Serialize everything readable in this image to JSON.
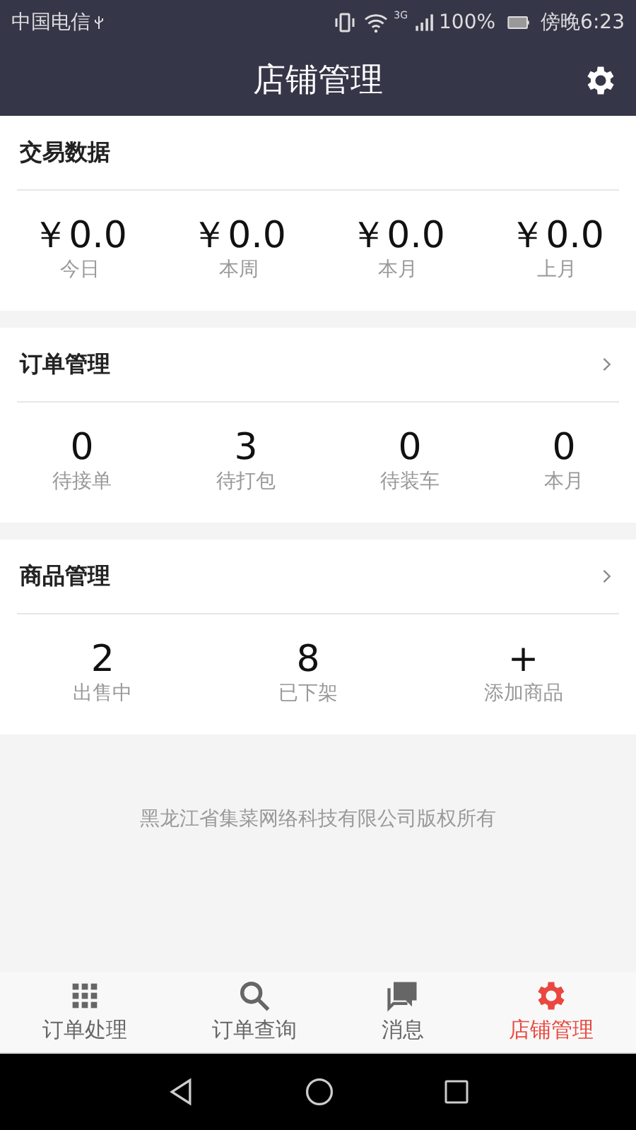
{
  "status_bar": {
    "carrier": "中国电信",
    "network": "3G",
    "battery": "100%",
    "time": "傍晚6:23"
  },
  "header": {
    "title": "店铺管理"
  },
  "sections": [
    {
      "title": "交易数据",
      "kind": "plain",
      "stats": [
        {
          "value": "￥0.0",
          "label": "今日"
        },
        {
          "value": "￥0.0",
          "label": "本周"
        },
        {
          "value": "￥0.0",
          "label": "本月"
        },
        {
          "value": "￥0.0",
          "label": "上月"
        }
      ]
    },
    {
      "title": "订单管理",
      "kind": "link",
      "stats": [
        {
          "value": "0",
          "label": "待接单"
        },
        {
          "value": "3",
          "label": "待打包"
        },
        {
          "value": "0",
          "label": "待装车"
        },
        {
          "value": "0",
          "label": "本月"
        }
      ]
    },
    {
      "title": "商品管理",
      "kind": "link",
      "stats": [
        {
          "value": "2",
          "label": "出售中"
        },
        {
          "value": "8",
          "label": "已下架"
        },
        {
          "value": "+",
          "label": "添加商品"
        }
      ]
    }
  ],
  "footer": "黑龙江省集菜网络科技有限公司版权所有",
  "bottom_nav": [
    {
      "label": "订单处理",
      "selected": false
    },
    {
      "label": "订单查询",
      "selected": false
    },
    {
      "label": "消息",
      "selected": false
    },
    {
      "label": "店铺管理",
      "selected": true
    }
  ]
}
